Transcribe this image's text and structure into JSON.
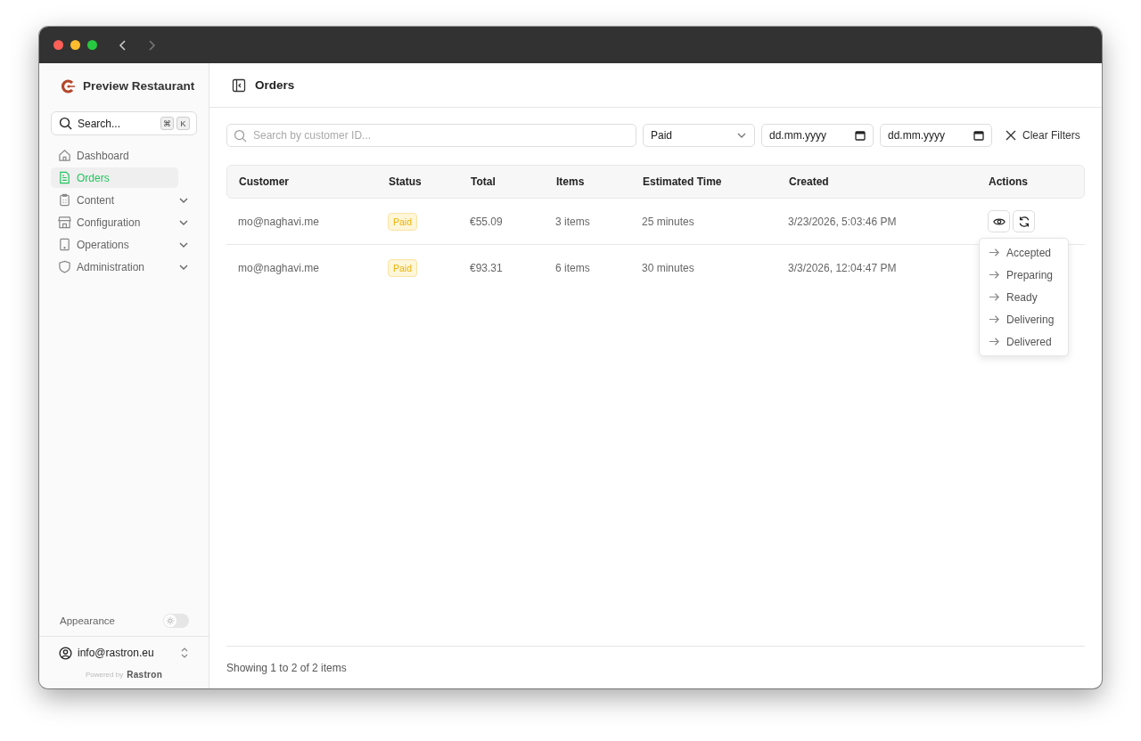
{
  "sidebar": {
    "brand": "Preview Restaurant",
    "search": {
      "placeholder": "Search...",
      "keys": [
        "⌘",
        "K"
      ]
    },
    "items": [
      {
        "label": "Dashboard",
        "selected": false
      },
      {
        "label": "Orders",
        "selected": true
      },
      {
        "label": "Content",
        "selected": false,
        "expanded": false
      },
      {
        "label": "Configuration",
        "selected": false,
        "expanded": false
      },
      {
        "label": "Operations",
        "selected": false,
        "expanded": false
      },
      {
        "label": "Administration",
        "selected": false,
        "expanded": false
      }
    ],
    "appearance": {
      "label": "Appearance",
      "on": false
    },
    "user": "info@rastron.eu",
    "powered_by": "Powered by",
    "powered_brand": "Rastron"
  },
  "header": {
    "title": "Orders"
  },
  "filters": {
    "search": {
      "placeholder": "Search by customer ID..."
    },
    "status": "Paid",
    "date_from": "dd.mm.yyyy",
    "date_to": "dd.mm.yyyy",
    "clear": "Clear Filters"
  },
  "table": {
    "columns": [
      "Customer",
      "Status",
      "Total",
      "Items",
      "Estimated Time",
      "Created",
      "Actions"
    ],
    "rows": [
      {
        "customer": "mo@naghavi.me",
        "status": "Paid",
        "total": "€55.09",
        "items": "3 items",
        "estimated": "25 minutes",
        "created": "3/23/2026, 5:03:46 PM",
        "menu_open": true
      },
      {
        "customer": "mo@naghavi.me",
        "status": "Paid",
        "total": "€93.31",
        "items": "6 items",
        "estimated": "30 minutes",
        "created": "3/3/2026, 12:04:47 PM",
        "menu_open": false
      }
    ]
  },
  "status_menu": [
    "Accepted",
    "Preparing",
    "Ready",
    "Delivering",
    "Delivered"
  ],
  "footer": "Showing 1 to 2 of 2 items"
}
